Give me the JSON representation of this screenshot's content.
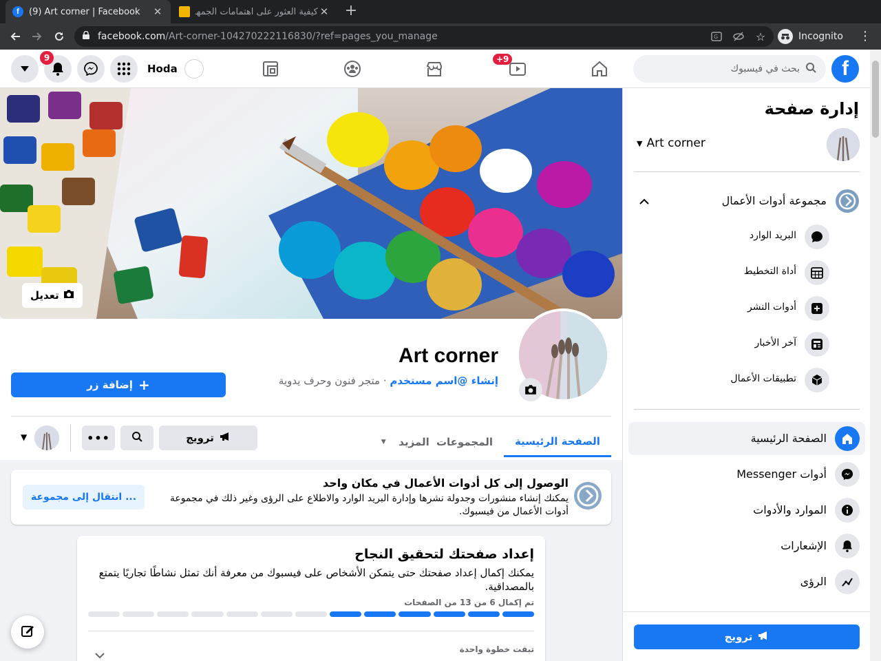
{
  "browser": {
    "tabs": [
      {
        "title": "(9) Art corner | Facebook",
        "active": true
      },
      {
        "title": "كيفية العثور على اهتمامات الجمهور",
        "active": false
      }
    ],
    "url_host": "facebook.com",
    "url_path": "/Art-corner-104270222116830/?ref=pages_you_manage",
    "incognito_label": "Incognito"
  },
  "fb": {
    "search_placeholder": "بحث في فيسبوك",
    "watch_badge": "+9",
    "notif_badge": "9",
    "user_name": "Hoda"
  },
  "cover": {
    "edit_label": "تعديل"
  },
  "page": {
    "name": "Art corner",
    "create_username": "إنشاء @اسم مستخدم",
    "separator": "·",
    "category": "متجر فنون وحرف يدوية",
    "add_button": "إضافة زر"
  },
  "tabs": {
    "home": "الصفحة الرئيسية",
    "groups": "المجموعات",
    "more": "المزيد",
    "promote": "ترويج"
  },
  "business_card": {
    "title": "الوصول إلى كل أدوات الأعمال في مكان واحد",
    "desc": "يمكنك إنشاء منشورات وجدولة نشرها وإدارة البريد الوارد والاطلاع على الرؤى وغير ذلك في مجموعة أدوات الأعمال من فيسبوك.",
    "button": "انتقال إلى مجموعة ..."
  },
  "setup_card": {
    "title": "إعداد صفحتك لتحقيق النجاح",
    "desc": "يمكنك إكمال إعداد صفحتك حتى يتمكن الأشخاص على فيسبوك من معرفة أنك تمثل نشاطًا تجاريًا يتمتع بالمصداقية.",
    "progress_label": "تم إكمال 6 من 13 من الصفحات",
    "steps_done": 6,
    "steps_total": 13,
    "step_left": "تبقت خطوة واحدة"
  },
  "sidebar": {
    "title": "إدارة صفحة",
    "page_name": "Art corner",
    "business_suite": "مجموعة أدوات الأعمال",
    "sub_items": [
      {
        "label": "البريد الوارد",
        "icon": "chat-bubble-icon"
      },
      {
        "label": "أداة التخطيط",
        "icon": "calendar-grid-icon"
      },
      {
        "label": "أدوات النشر",
        "icon": "publishing-tools-icon"
      },
      {
        "label": "آخر الأخبار",
        "icon": "news-feed-icon"
      },
      {
        "label": "تطبيقات الأعمال",
        "icon": "cube-icon"
      }
    ],
    "menu": [
      {
        "label": "الصفحة الرئيسية",
        "icon": "home-icon",
        "active": true
      },
      {
        "label": "أدوات Messenger",
        "icon": "messenger-icon",
        "active": false
      },
      {
        "label": "الموارد والأدوات",
        "icon": "info-icon",
        "active": false
      },
      {
        "label": "الإشعارات",
        "icon": "bell-icon",
        "active": false
      },
      {
        "label": "الرؤى",
        "icon": "insights-icon",
        "active": false
      }
    ],
    "promote": "ترويج"
  },
  "colors": {
    "brand": "#1877f2",
    "badge": "#e41e3f",
    "chrome_dark": "#202124"
  }
}
